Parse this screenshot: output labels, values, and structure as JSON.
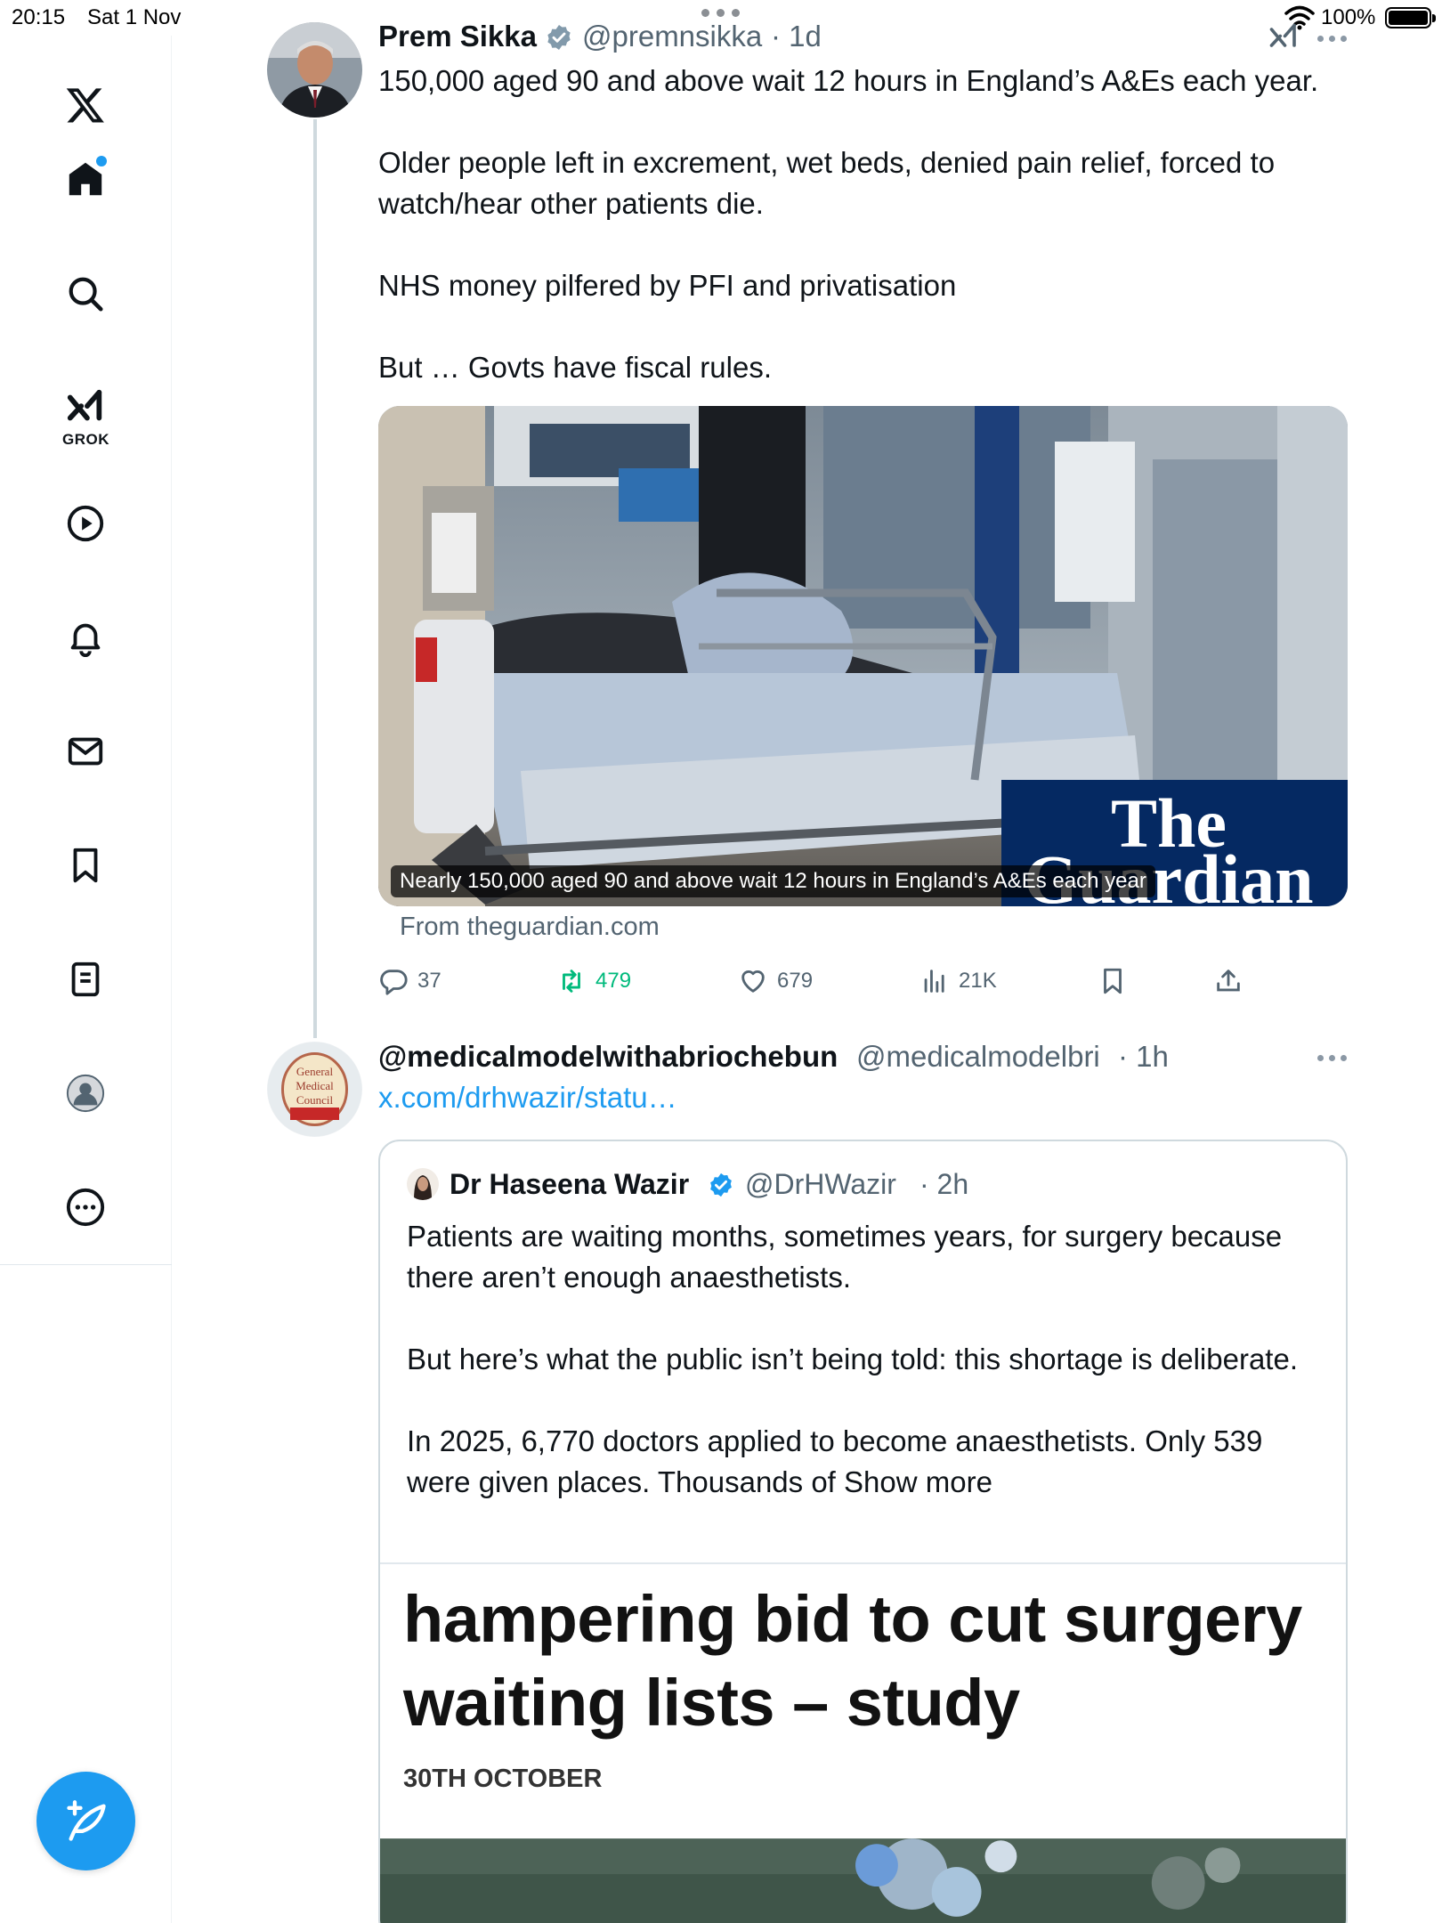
{
  "status_bar": {
    "time": "20:15",
    "date": "Sat 1 Nov",
    "battery": "100%"
  },
  "sidebar": {
    "items": [
      {
        "name": "x-logo",
        "label": "X"
      },
      {
        "name": "home",
        "label": "Home"
      },
      {
        "name": "explore",
        "label": "Explore"
      },
      {
        "name": "grok",
        "label": "GROK"
      },
      {
        "name": "video",
        "label": "Video"
      },
      {
        "name": "notifications",
        "label": "Notifications"
      },
      {
        "name": "messages",
        "label": "Messages"
      },
      {
        "name": "bookmarks",
        "label": "Bookmarks"
      },
      {
        "name": "lists",
        "label": "Lists"
      },
      {
        "name": "profile",
        "label": "Profile"
      },
      {
        "name": "more",
        "label": "More"
      }
    ],
    "grok_label": "GROK",
    "accent": "#1d9bf0"
  },
  "tweet1": {
    "name": "Prem Sikka",
    "handle": "@premnsikka",
    "time": "· 1d",
    "paragraphs": [
      "150,000 aged 90 and above wait 12 hours in England’s A&Es each year.",
      "Older people left in excrement, wet beds, denied pain relief, forced to watch/hear other patients die.",
      "NHS money pilfered by PFI and privatisation",
      "But … Govts have fiscal rules."
    ],
    "media": {
      "caption": "Nearly 150,000 aged 90 and above wait 12 hours in England’s A&Es each year",
      "source": "From theguardian.com",
      "logo_line1": "The",
      "logo_line2": "Guardian"
    },
    "actions": {
      "replies": "37",
      "reposts": "479",
      "likes": "679",
      "views": "21K"
    },
    "repost_color": "#00ba7c"
  },
  "tweet2": {
    "name": "@medicalmodelwithabriochebun",
    "handle": "@medicalmodelbri",
    "time": "· 1h",
    "link": "x.com/drhwazir/statu…",
    "quote": {
      "name": "Dr Haseena Wazir",
      "handle": "@DrHWazir",
      "time": "· 2h",
      "paragraphs": [
        "Patients are waiting months, sometimes years, for surgery because there aren’t enough anaesthetists.",
        "But here’s what the public isn’t being told: this shortage is deliberate.",
        "In 2025, 6,770 doctors applied to become anaesthetists. Only 539 were given places. Thousands of Show more"
      ],
      "headline": "hampering bid to cut surgery waiting lists – study",
      "date": "30TH OCTOBER"
    }
  }
}
